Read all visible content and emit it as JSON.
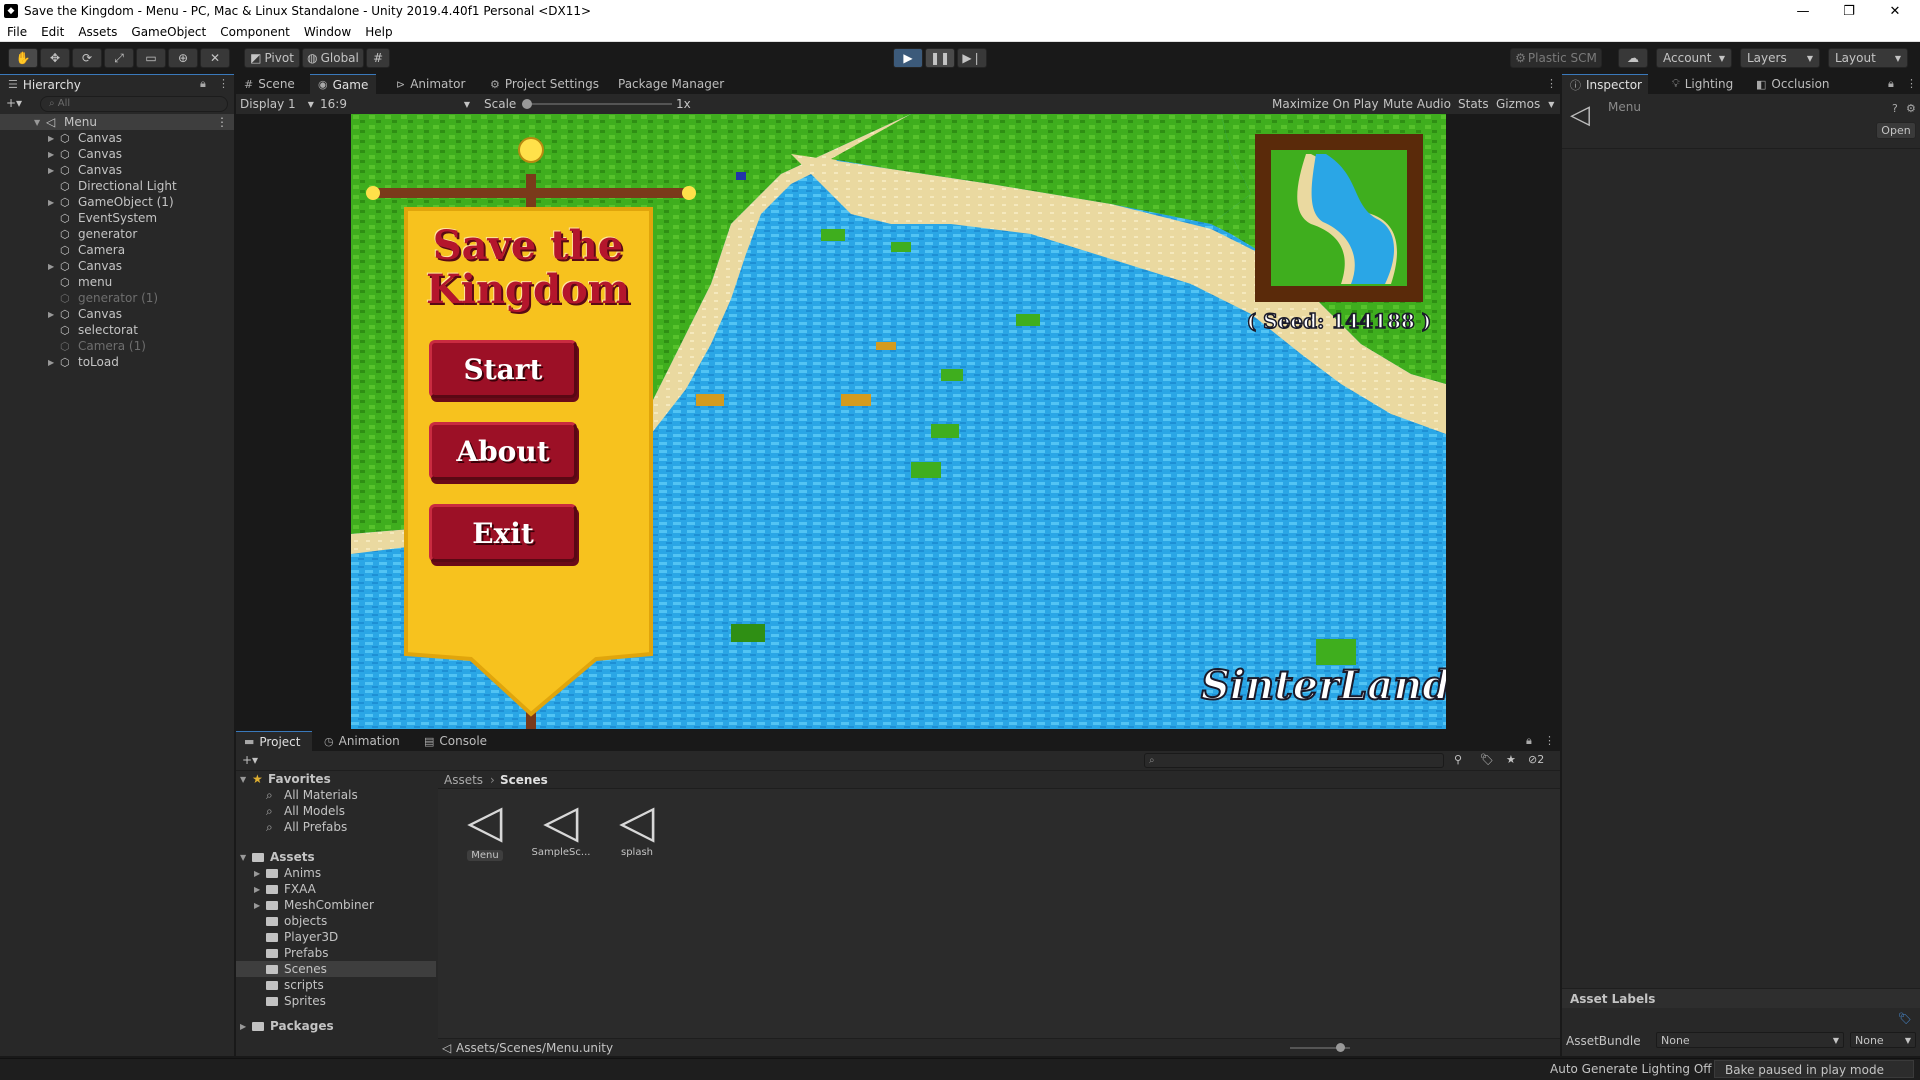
{
  "window": {
    "title": "Save the Kingdom - Menu - PC, Mac & Linux Standalone - Unity 2019.4.40f1 Personal <DX11>"
  },
  "menubar": [
    "File",
    "Edit",
    "Assets",
    "GameObject",
    "Component",
    "Window",
    "Help"
  ],
  "toolbar": {
    "pivot": "Pivot",
    "global": "Global",
    "plastic": "Plastic SCM",
    "account": "Account",
    "layers": "Layers",
    "layout": "Layout"
  },
  "hierarchy": {
    "tab": "Hierarchy",
    "search_placeholder": "All",
    "root": "Menu",
    "items": [
      {
        "label": "Canvas",
        "expandable": true,
        "active": true
      },
      {
        "label": "Canvas",
        "expandable": true,
        "active": true
      },
      {
        "label": "Canvas",
        "expandable": true,
        "active": true
      },
      {
        "label": "Directional Light",
        "expandable": false,
        "active": true
      },
      {
        "label": "GameObject (1)",
        "expandable": true,
        "active": true
      },
      {
        "label": "EventSystem",
        "expandable": false,
        "active": true
      },
      {
        "label": "generator",
        "expandable": false,
        "active": true
      },
      {
        "label": "Camera",
        "expandable": false,
        "active": true
      },
      {
        "label": "Canvas",
        "expandable": true,
        "active": true
      },
      {
        "label": "menu",
        "expandable": false,
        "active": true
      },
      {
        "label": "generator (1)",
        "expandable": false,
        "active": false
      },
      {
        "label": "Canvas",
        "expandable": true,
        "active": true
      },
      {
        "label": "selectorat",
        "expandable": false,
        "active": true
      },
      {
        "label": "Camera (1)",
        "expandable": false,
        "active": false
      },
      {
        "label": "toLoad",
        "expandable": true,
        "active": true
      }
    ]
  },
  "center_tabs": [
    "Scene",
    "Game",
    "Animator",
    "Project Settings",
    "Package Manager"
  ],
  "game_toolbar": {
    "display": "Display 1",
    "aspect": "16:9",
    "scale_label": "Scale",
    "scale_value": "1x",
    "maximize": "Maximize On Play",
    "mute": "Mute Audio",
    "stats": "Stats",
    "gizmos": "Gizmos"
  },
  "game": {
    "title_line1": "Save the",
    "title_line2": "Kingdom",
    "buttons": [
      "Start",
      "About",
      "Exit"
    ],
    "seed_label": "( Seed: 144188 )",
    "logo": "SinterLand",
    "colors": {
      "banner": "#f7c21e",
      "button": "#9c1026",
      "title": "#b4162c",
      "water": "#29a6e6",
      "grass": "#3fae1e",
      "sand": "#ead9a0",
      "sky": "#5fd8f0"
    }
  },
  "inspector": {
    "tabs": [
      "Inspector",
      "Lighting",
      "Occlusion"
    ],
    "object_name": "Menu",
    "open_button": "Open",
    "asset_labels": "Asset Labels",
    "asset_bundle_label": "AssetBundle",
    "asset_bundle_value": "None",
    "asset_bundle_variant": "None"
  },
  "project": {
    "tabs": [
      "Project",
      "Animation",
      "Console"
    ],
    "hidden_count": "2",
    "favorites_label": "Favorites",
    "favorites": [
      "All Materials",
      "All Models",
      "All Prefabs"
    ],
    "assets_label": "Assets",
    "folders": [
      "Anims",
      "FXAA",
      "MeshCombiner",
      "objects",
      "Player3D",
      "Prefabs",
      "Scenes",
      "scripts",
      "Sprites"
    ],
    "packages_label": "Packages",
    "breadcrumb_root": "Assets",
    "breadcrumb_current": "Scenes",
    "files": [
      "Menu",
      "SampleSc...",
      "splash"
    ],
    "path": "Assets/Scenes/Menu.unity"
  },
  "statusbar": {
    "lighting": "Auto Generate Lighting Off",
    "bake": "Bake paused in play mode"
  }
}
